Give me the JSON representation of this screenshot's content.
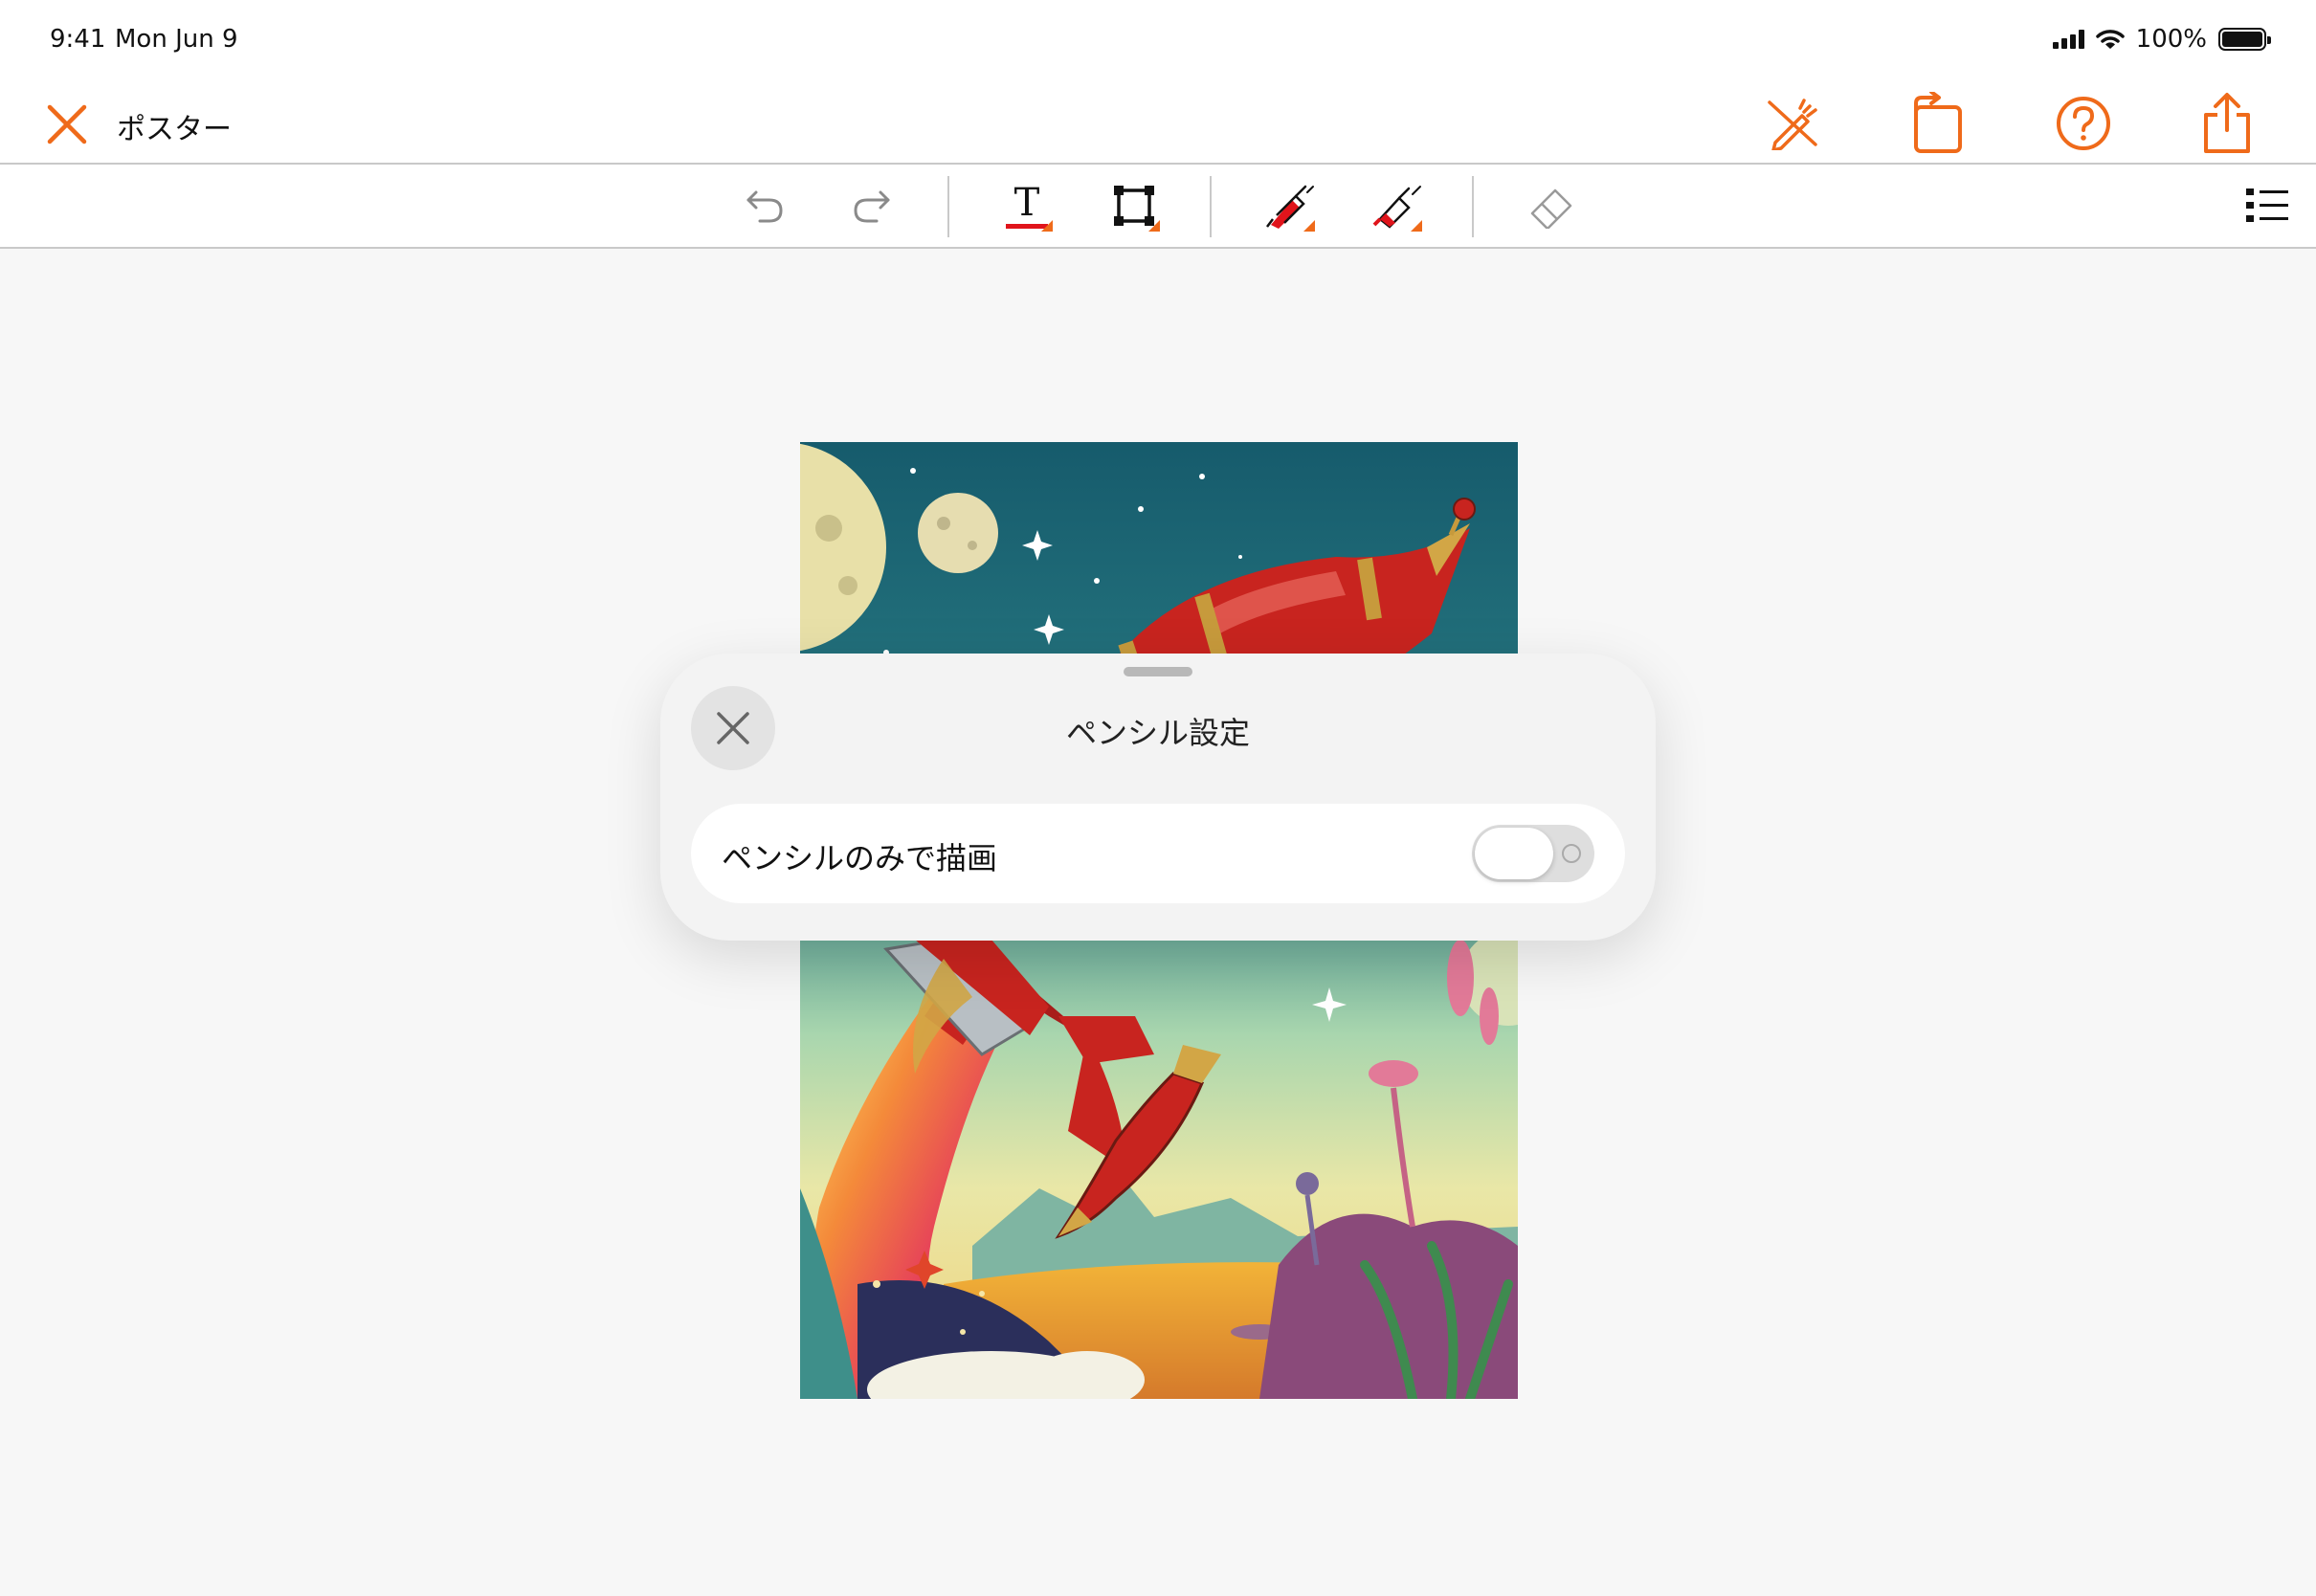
{
  "status_bar": {
    "time": "9:41",
    "date": "Mon Jun 9",
    "battery": "100%"
  },
  "nav": {
    "title": "ポスター",
    "accent": "#ef6a1a",
    "actions": [
      "pencil-mode-icon",
      "rotate-page-icon",
      "help-icon",
      "share-icon"
    ]
  },
  "toolbar": {
    "tools": [
      "undo-icon",
      "redo-icon",
      "text-tool-icon",
      "shape-tool-icon",
      "pen-tool-icon",
      "highlighter-tool-icon",
      "eraser-icon",
      "list-icon"
    ],
    "text_tool_glyph": "T",
    "active_color": "#e0141b"
  },
  "sheet": {
    "title": "ペンシル設定",
    "option_label": "ペンシルのみで描画",
    "option_enabled": false
  }
}
